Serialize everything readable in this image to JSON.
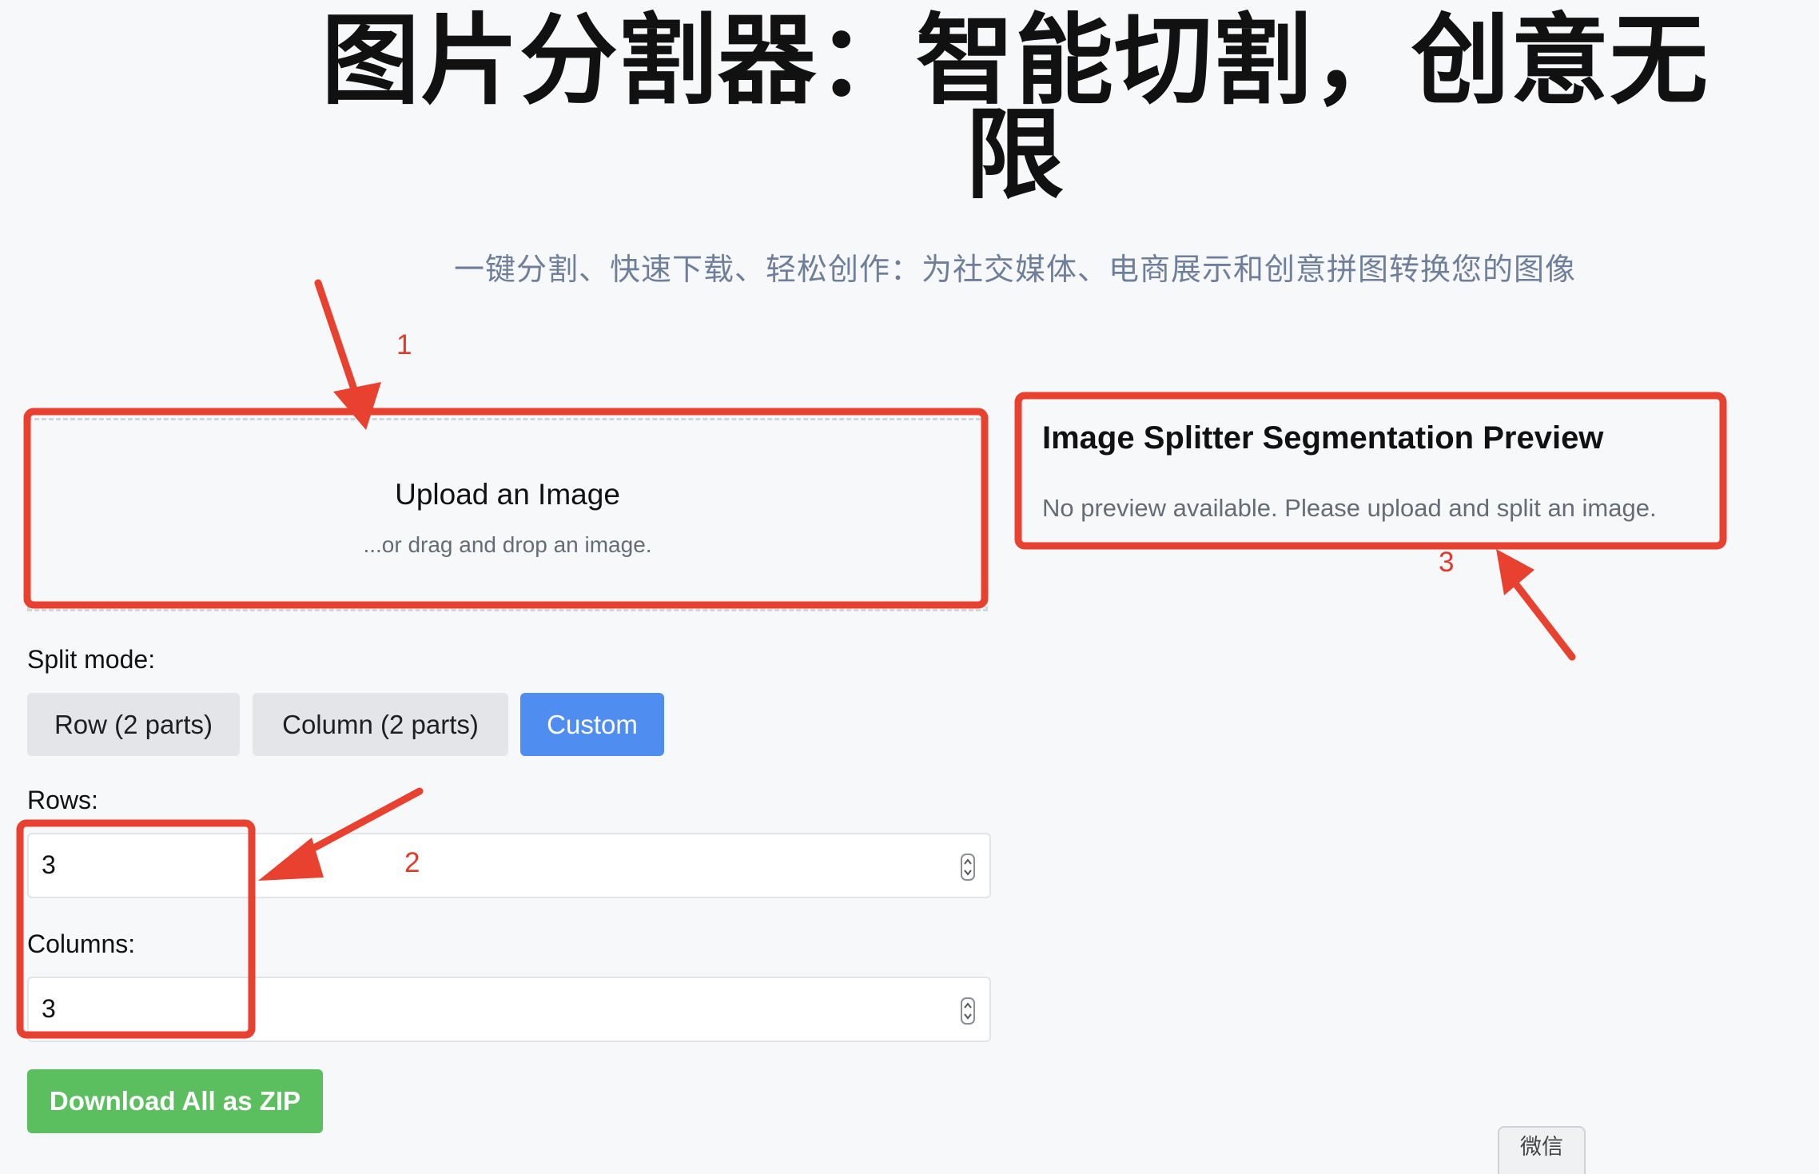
{
  "header": {
    "title": "图片分割器：智能切割，创意无限",
    "subtitle": "一键分割、快速下载、轻松创作：为社交媒体、电商展示和创意拼图转换您的图像"
  },
  "upload": {
    "title": "Upload an Image",
    "hint": "...or drag and drop an image."
  },
  "preview": {
    "title": "Image Splitter Segmentation Preview",
    "message": "No preview available. Please upload and split an image."
  },
  "controls": {
    "split_mode_label": "Split mode:",
    "modes": [
      {
        "label": "Row (2 parts)",
        "active": false
      },
      {
        "label": "Column (2 parts)",
        "active": false
      },
      {
        "label": "Custom",
        "active": true
      }
    ],
    "rows_label": "Rows:",
    "rows_value": "3",
    "columns_label": "Columns:",
    "columns_value": "3",
    "download_label": "Download All as ZIP"
  },
  "footer": {
    "wechat_label": "微信"
  },
  "annotations": {
    "markers": [
      "1",
      "2",
      "3"
    ],
    "color": "#e8412f"
  },
  "colors": {
    "background": "#f7f8fa",
    "accent": "#4f8ef0",
    "download": "#5cbf5f",
    "subtitle": "#6f7f9a"
  }
}
